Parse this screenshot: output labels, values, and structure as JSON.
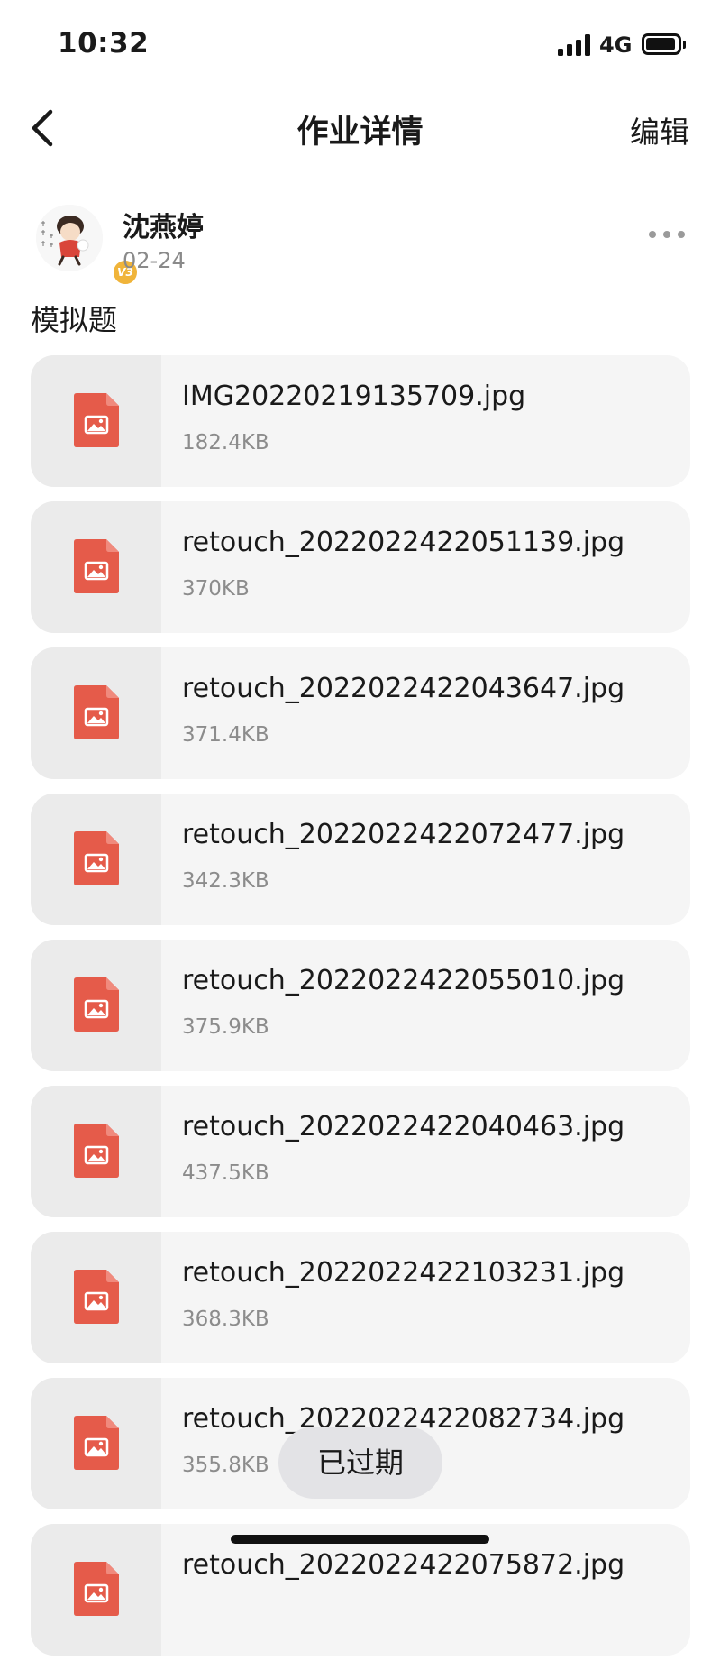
{
  "status_bar": {
    "time": "10:32",
    "network": "4G"
  },
  "nav": {
    "title": "作业详情",
    "edit_label": "编辑"
  },
  "author": {
    "name": "沈燕婷",
    "date": "02-24",
    "badge": "V3"
  },
  "section_title": "模拟题",
  "files": [
    {
      "name": "IMG20220219135709.jpg",
      "size": "182.4KB"
    },
    {
      "name": "retouch_2022022422051139.jpg",
      "size": "370KB"
    },
    {
      "name": "retouch_2022022422043647.jpg",
      "size": "371.4KB"
    },
    {
      "name": "retouch_2022022422072477.jpg",
      "size": "342.3KB"
    },
    {
      "name": "retouch_2022022422055010.jpg",
      "size": "375.9KB"
    },
    {
      "name": "retouch_2022022422040463.jpg",
      "size": "437.5KB"
    },
    {
      "name": "retouch_2022022422103231.jpg",
      "size": "368.3KB"
    },
    {
      "name": "retouch_2022022422082734.jpg",
      "size": "355.8KB"
    },
    {
      "name": "retouch_2022022422075872.jpg",
      "size": ""
    }
  ],
  "toast": {
    "text": "已过期"
  },
  "colors": {
    "file_icon": "#e55b4a",
    "card_bg": "#f5f5f5",
    "thumb_bg": "#ebebeb",
    "toast_bg": "#e3e3e6",
    "badge": "#f0b43a"
  },
  "icons": {
    "back": "chevron-left-icon",
    "more": "more-horizontal-icon",
    "file": "image-file-icon"
  }
}
